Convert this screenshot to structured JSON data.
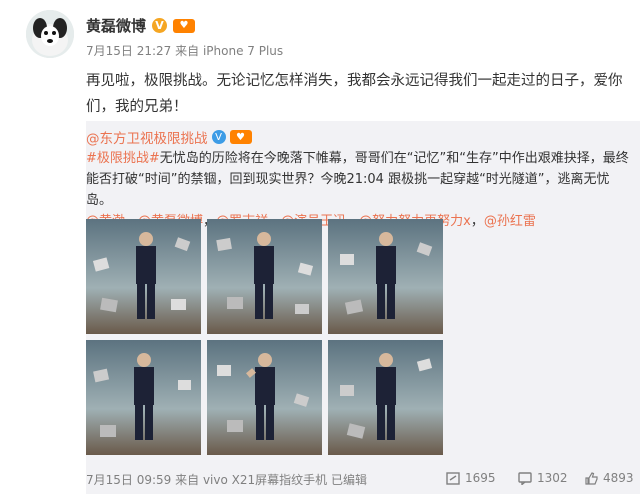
{
  "post": {
    "author": "黄磊微博",
    "verified_badge": "V",
    "meta_time": "7月15日 21:27",
    "meta_source": "来自 iPhone 7 Plus",
    "text": "再见啦，极限挑战。无论记忆怎样消失，我都会永远记得我们一起走过的日子，爱你们，我的兄弟！"
  },
  "repost": {
    "author": "@东方卫视极限挑战",
    "verified_badge": "V",
    "hashtag": "#极限挑战#",
    "text_part1": "无忧岛的历险将在今晚落下帷幕，哥哥们在“记忆”和“生存”中作出艰难抉择，最终能否打破“时间”的禁锢，回到现实世界？今晚21:04 跟极挑一起穿越“时光隧道”，逃离无忧岛。",
    "mentions": [
      "@黄渤",
      "@黄磊微博",
      "@罗志祥",
      "@演员王迅",
      "@努力努力再努力x",
      "@孙红雷"
    ],
    "footer_time": "7月15日 09:59",
    "footer_source": "来自 vivo X21屏幕指纹手机",
    "footer_edited": "已编辑",
    "reposts": "1695",
    "comments": "1302",
    "likes": "4893"
  },
  "colors": {
    "link": "#eb7350",
    "repost_bg": "#f2f2f5",
    "badge_gold": "#f5a623",
    "badge_blue": "#3d9ce6"
  },
  "icons": [
    "avatar-dog",
    "verified-icon",
    "repost-icon",
    "comment-icon",
    "like-icon"
  ]
}
